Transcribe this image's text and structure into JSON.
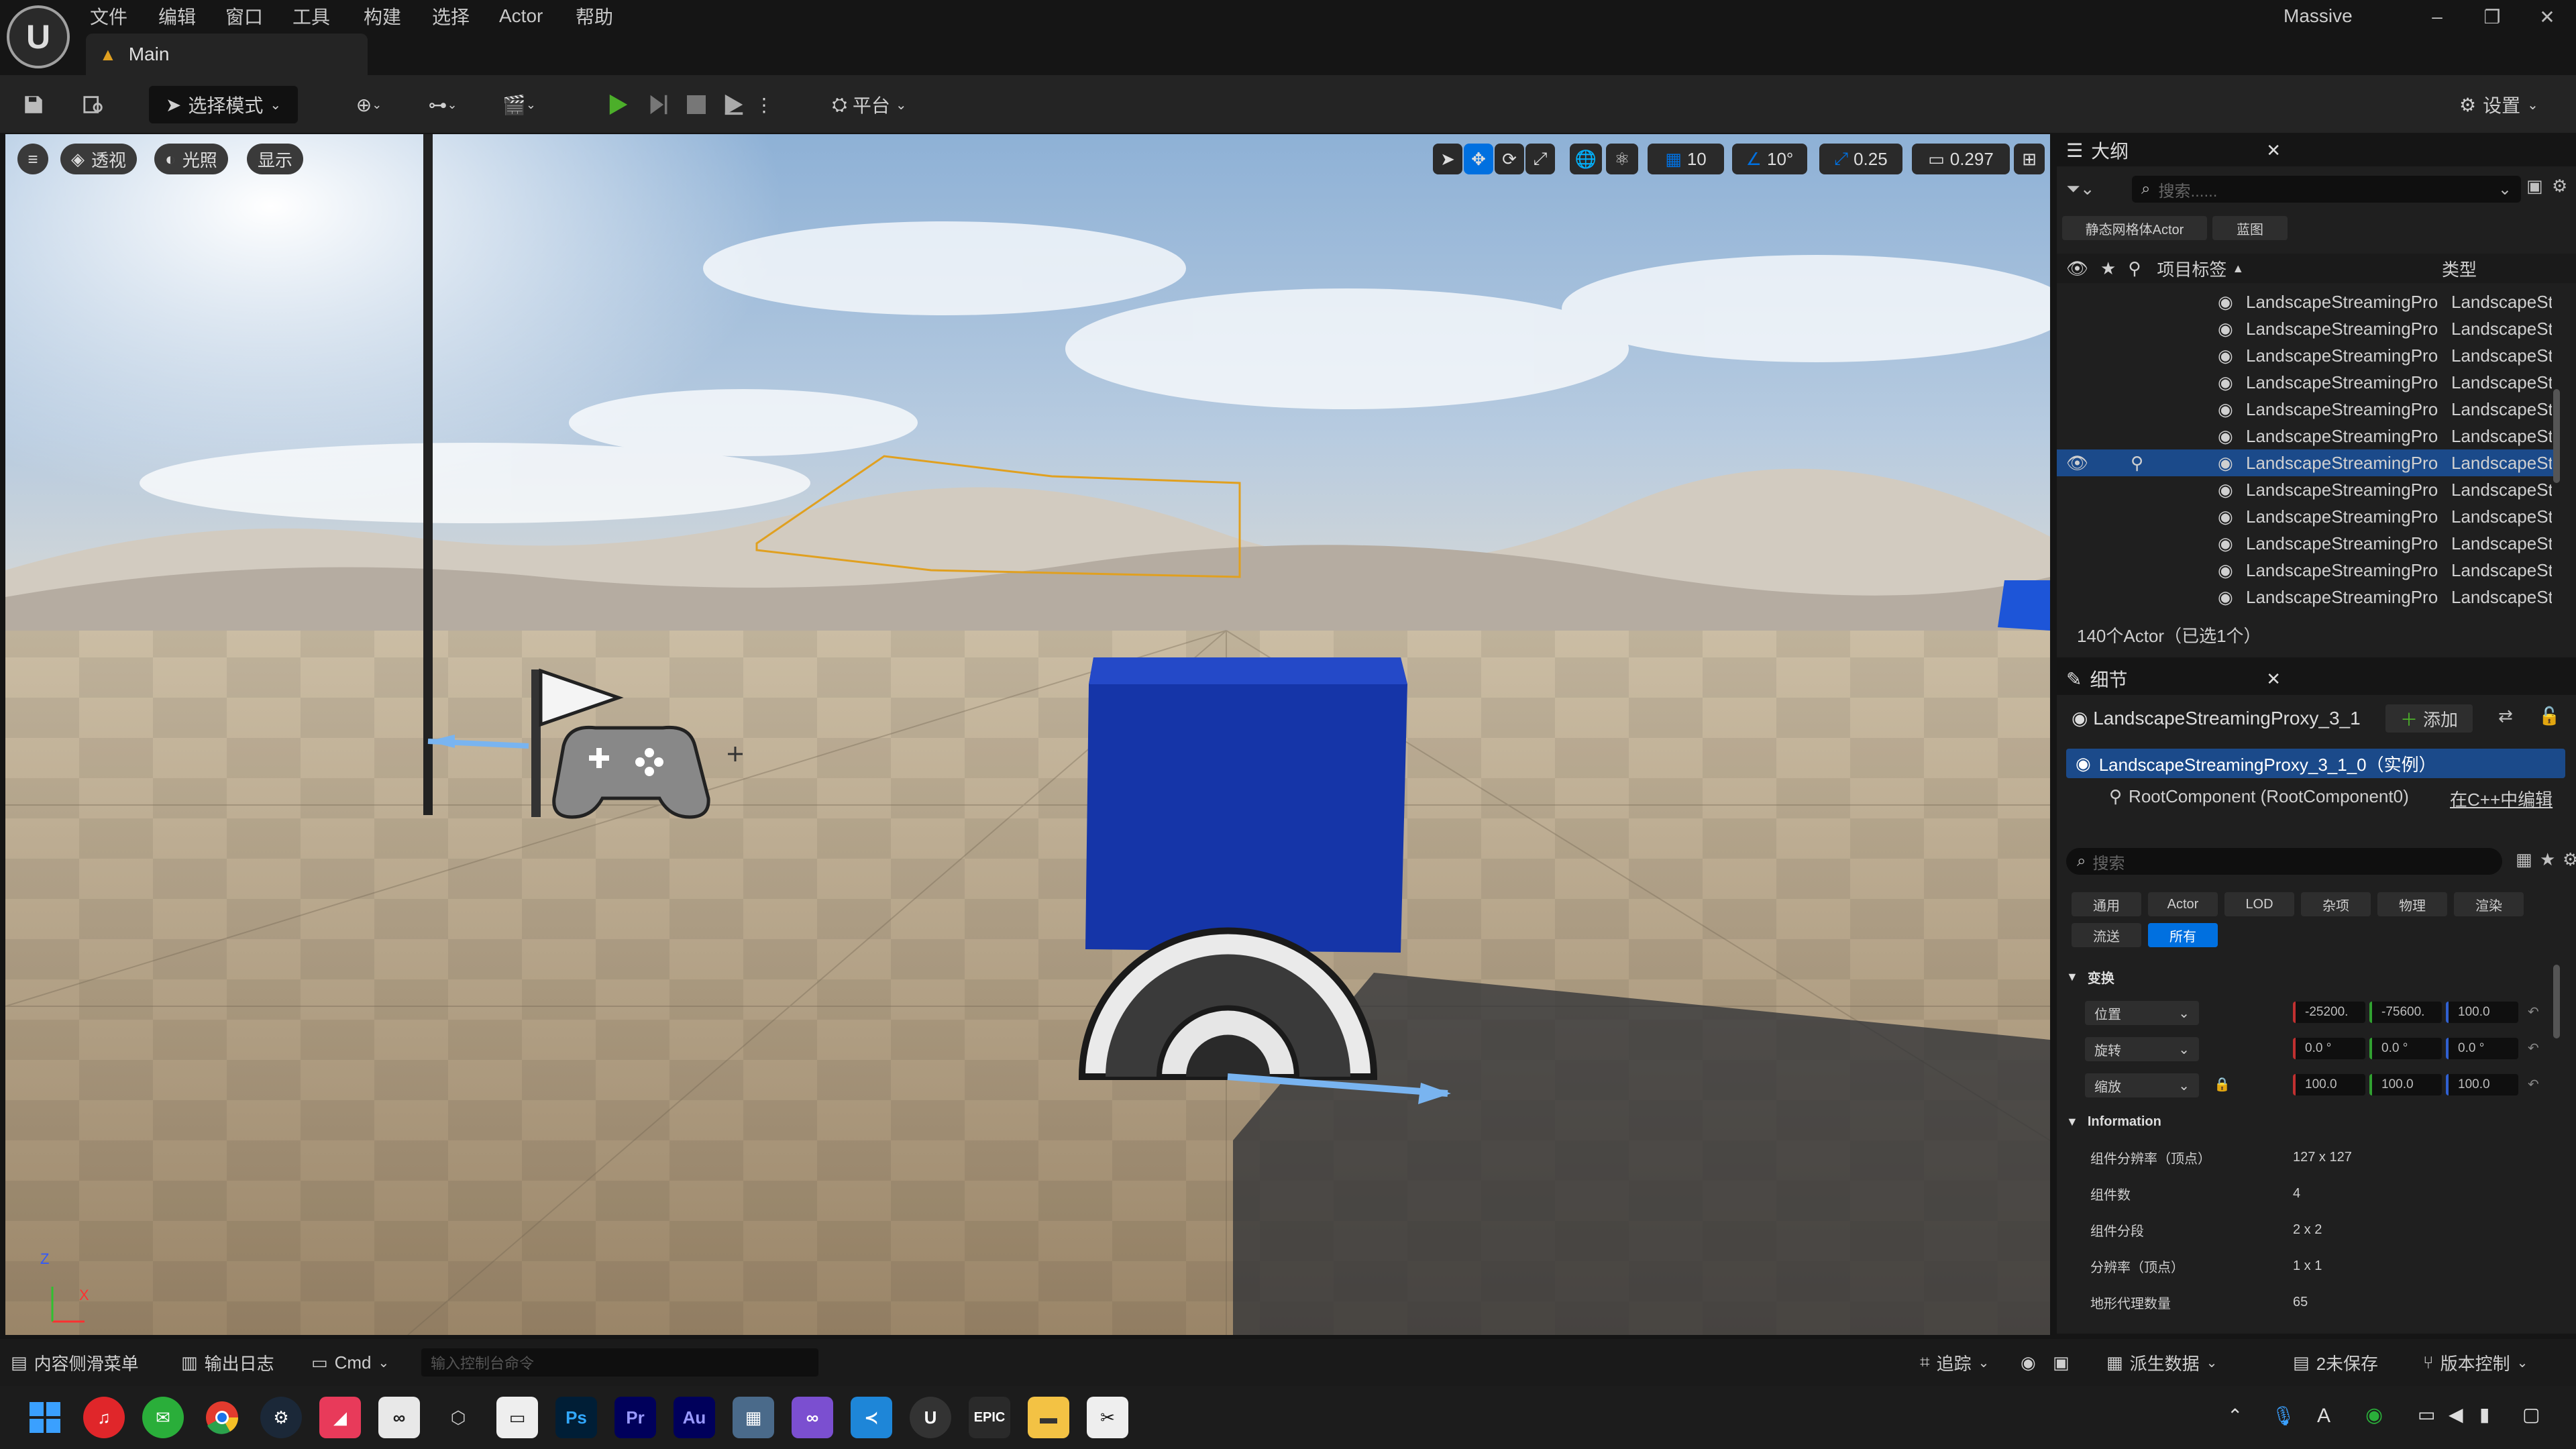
{
  "app": {
    "title": "Massive",
    "tab": "Main",
    "logo": "U"
  },
  "menu": [
    "文件",
    "编辑",
    "窗口",
    "工具",
    "构建",
    "选择",
    "Actor",
    "帮助"
  ],
  "window_controls": [
    "–",
    "❐",
    "✕"
  ],
  "toolbar": {
    "mode": "选择模式",
    "platform": "平台",
    "settings": "设置"
  },
  "viewport": {
    "left_buttons": {
      "menu": "≡",
      "perspective": "透视",
      "lighting": "光照",
      "show": "显示"
    },
    "grid_snap": "10",
    "angle_snap": "10°",
    "scale_snap": "0.25",
    "camera_speed": "0.297",
    "axis": {
      "z": "Z",
      "x": "X"
    }
  },
  "outliner": {
    "title": "大纲",
    "search_placeholder": "搜索......",
    "filters": [
      "静态网格体Actor",
      "蓝图"
    ],
    "col_label": "项目标签",
    "col_type": "类型",
    "rows": [
      {
        "name": "LandscapeStreamingPro",
        "type": "LandscapeSt"
      },
      {
        "name": "LandscapeStreamingPro",
        "type": "LandscapeSt"
      },
      {
        "name": "LandscapeStreamingPro",
        "type": "LandscapeSt"
      },
      {
        "name": "LandscapeStreamingPro",
        "type": "LandscapeSt"
      },
      {
        "name": "LandscapeStreamingPro",
        "type": "LandscapeSt"
      },
      {
        "name": "LandscapeStreamingPro",
        "type": "LandscapeSt"
      },
      {
        "name": "LandscapeStreamingPro",
        "type": "LandscapeSt"
      },
      {
        "name": "LandscapeStreamingPro",
        "type": "LandscapeSt"
      },
      {
        "name": "LandscapeStreamingPro",
        "type": "LandscapeSt"
      },
      {
        "name": "LandscapeStreamingPro",
        "type": "LandscapeSt"
      },
      {
        "name": "LandscapeStreamingPro",
        "type": "LandscapeSt"
      },
      {
        "name": "LandscapeStreamingPro",
        "type": "LandscapeSt"
      }
    ],
    "selected_index": 6,
    "footer": "140个Actor（已选1个）"
  },
  "details": {
    "title": "细节",
    "actor_name": "LandscapeStreamingProxy_3_1",
    "add_label": "添加",
    "instance": "LandscapeStreamingProxy_3_1_0（实例）",
    "root_component": "RootComponent (RootComponent0)",
    "edit_cpp": "在C++中编辑",
    "search_placeholder": "搜索",
    "categories_row1": [
      "通用",
      "Actor",
      "LOD",
      "杂项",
      "物理",
      "渲染"
    ],
    "categories_row2": [
      "流送",
      "所有"
    ],
    "active_category": "所有",
    "transform_label": "变换",
    "transform": [
      {
        "label": "位置",
        "x": "-25200.",
        "y": "-75600.",
        "z": "100.0"
      },
      {
        "label": "旋转",
        "x": "0.0 °",
        "y": "0.0 °",
        "z": "0.0 °"
      },
      {
        "label": "缩放",
        "x": "100.0",
        "y": "100.0",
        "z": "100.0"
      }
    ],
    "info_label": "Information",
    "info": [
      {
        "k": "组件分辨率（顶点）",
        "v": "127 x 127"
      },
      {
        "k": "组件数",
        "v": "4"
      },
      {
        "k": "组件分段",
        "v": "2 x 2"
      },
      {
        "k": "分辨率（顶点）",
        "v": "1 x 1"
      },
      {
        "k": "地形代理数量",
        "v": "65"
      }
    ]
  },
  "statusbar": {
    "content_drawer": "内容侧滑菜单",
    "output_log": "输出日志",
    "cmd": "Cmd",
    "cmd_placeholder": "输入控制台命令",
    "trace": "追踪",
    "derived_data": "派生数据",
    "unsaved": "2未保存",
    "source_control": "版本控制"
  },
  "taskbar": {
    "ps": "Ps",
    "pr": "Pr",
    "au": "Au",
    "ue": "U",
    "epic": "EPIC",
    "font": "A"
  },
  "colors": {
    "accent": "#0070e0",
    "play": "#4caf2a",
    "cube": "#1535a8",
    "selection": "#e0a020",
    "panel": "#1f1f1f"
  }
}
